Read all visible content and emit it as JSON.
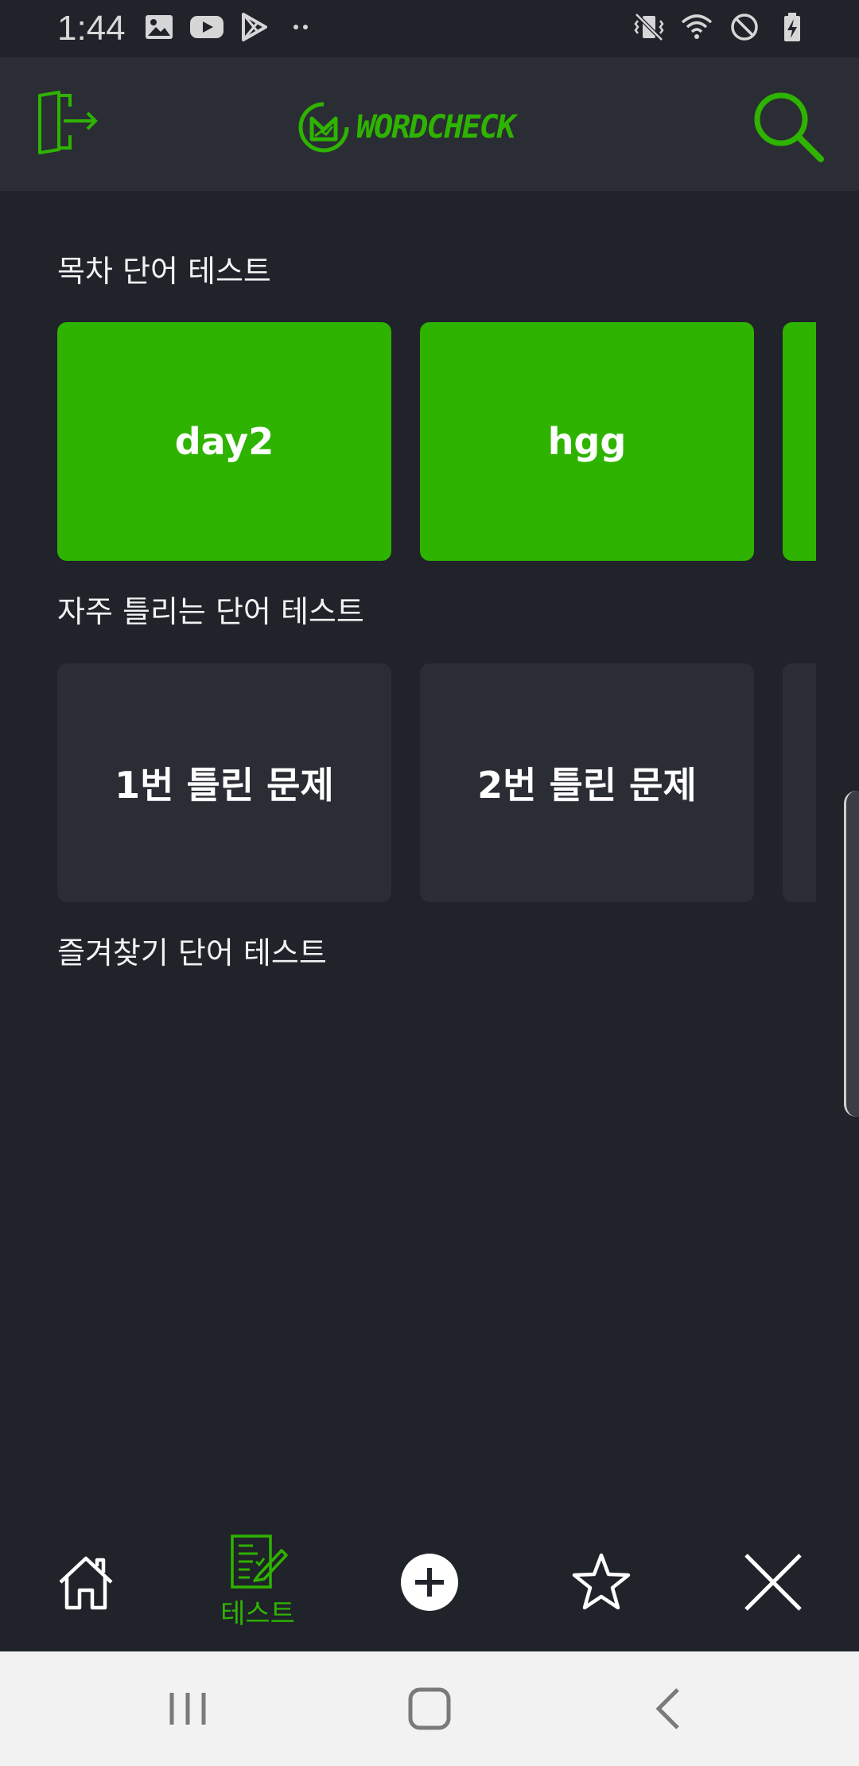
{
  "status_bar": {
    "time": "1:44",
    "left_icons": [
      "image-icon",
      "youtube-icon",
      "play-store-icon",
      "more-dots-icon"
    ],
    "right_icons": [
      "vibrate-icon",
      "wifi-icon",
      "do-not-disturb-icon",
      "battery-charging-icon"
    ]
  },
  "app_bar": {
    "logo_text": "WORDCHECK",
    "exit_icon": "exit-door-icon",
    "search_icon": "search-icon",
    "accent_color": "#2eb300"
  },
  "sections": {
    "toc": {
      "title": "목차 단어 테스트",
      "cards": [
        "day2",
        "hgg",
        ""
      ]
    },
    "wrong": {
      "title": "자주 틀리는 단어 테스트",
      "cards": [
        "1번 틀린 문제",
        "2번 틀린 문제",
        ""
      ]
    },
    "favorites": {
      "title": "즐겨찾기 단어 테스트"
    }
  },
  "bottom_nav": {
    "items": [
      {
        "icon": "home-icon",
        "label": ""
      },
      {
        "icon": "test-checklist-icon",
        "label": "테스트",
        "active": true
      },
      {
        "icon": "add-circle-icon",
        "label": ""
      },
      {
        "icon": "star-icon",
        "label": ""
      },
      {
        "icon": "close-icon",
        "label": ""
      }
    ]
  },
  "system_nav": {
    "items": [
      "recent-apps-icon",
      "home-button-icon",
      "back-icon"
    ]
  }
}
